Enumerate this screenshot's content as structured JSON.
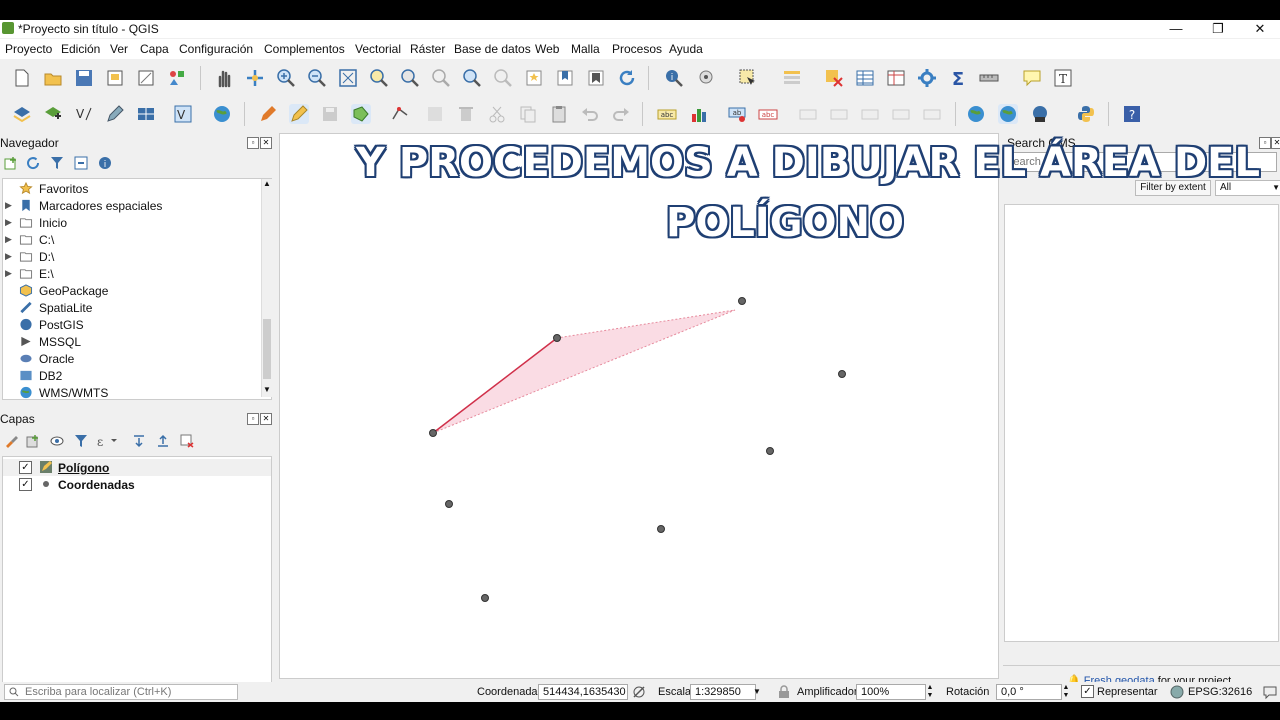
{
  "window": {
    "title": "*Proyecto sin título - QGIS"
  },
  "menu": [
    "Proyecto",
    "Edición",
    "Ver",
    "Capa",
    "Configuración",
    "Complementos",
    "Vectorial",
    "Ráster",
    "Base de datos",
    "Web",
    "Malla",
    "Procesos",
    "Ayuda"
  ],
  "navigator": {
    "title": "Navegador",
    "items": [
      {
        "label": "Favoritos",
        "icon": "star-icon",
        "expandable": false
      },
      {
        "label": "Marcadores espaciales",
        "icon": "bookmark-icon",
        "expandable": true
      },
      {
        "label": "Inicio",
        "icon": "folder-icon",
        "expandable": true
      },
      {
        "label": "C:\\",
        "icon": "folder-icon",
        "expandable": true
      },
      {
        "label": "D:\\",
        "icon": "folder-icon",
        "expandable": true
      },
      {
        "label": "E:\\",
        "icon": "folder-icon",
        "expandable": true
      },
      {
        "label": "GeoPackage",
        "icon": "geopackage-icon",
        "expandable": false
      },
      {
        "label": "SpatiaLite",
        "icon": "spatialite-icon",
        "expandable": false
      },
      {
        "label": "PostGIS",
        "icon": "postgis-icon",
        "expandable": false
      },
      {
        "label": "MSSQL",
        "icon": "mssql-icon",
        "expandable": false
      },
      {
        "label": "Oracle",
        "icon": "oracle-icon",
        "expandable": false
      },
      {
        "label": "DB2",
        "icon": "db2-icon",
        "expandable": false
      },
      {
        "label": "WMS/WMTS",
        "icon": "globe-icon",
        "expandable": false
      }
    ]
  },
  "layers": {
    "title": "Capas",
    "items": [
      {
        "label": "Polígono",
        "checked": true,
        "icon": "polygon-edit-icon"
      },
      {
        "label": "Coordenadas",
        "checked": true,
        "icon": "point-icon"
      }
    ]
  },
  "overlay": {
    "line1": "Y PROCEDEMOS A DIBUJAR EL ÁREA DEL",
    "line2": "POLÍGONO"
  },
  "qms": {
    "title": "Search QMS",
    "search_placeholder": "Search...",
    "filter_label": "Filter by extent",
    "filter_value": "All",
    "footer_link": "Fresh geodata",
    "footer_text": " for your project"
  },
  "status": {
    "locate_placeholder": "Escriba para localizar (Ctrl+K)",
    "coord_label": "Coordenada",
    "coord_value": "514434,1635430",
    "scale_label": "Escala",
    "scale_value": "1:329850",
    "magnifier_label": "Amplificador",
    "magnifier_value": "100%",
    "rotation_label": "Rotación",
    "rotation_value": "0,0 °",
    "render_label": "Representar",
    "crs": "EPSG:32616"
  },
  "colors": {
    "polygon_fill": "#f9d6df",
    "polygon_edge": "#d0304a",
    "overlay_text": "#ffffff",
    "overlay_outline": "#1f3f73"
  }
}
